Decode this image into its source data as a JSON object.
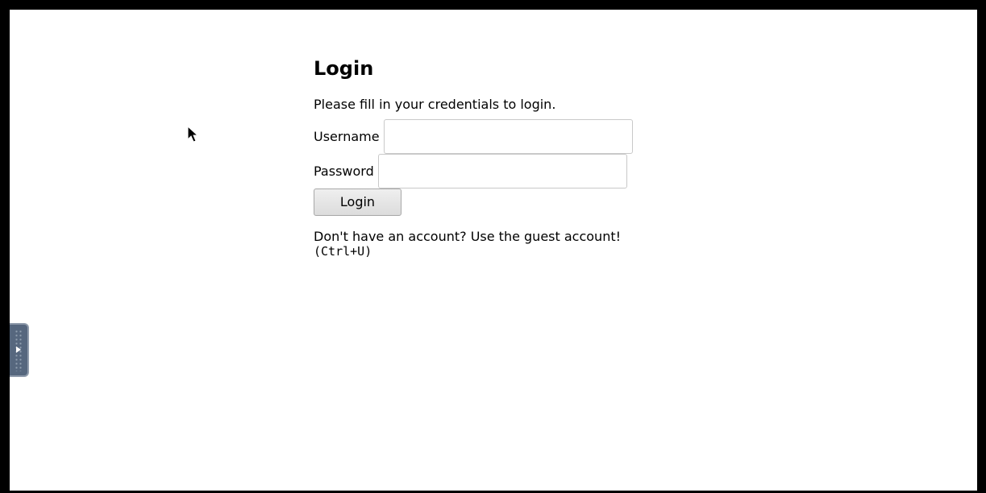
{
  "login": {
    "title": "Login",
    "intro": "Please fill in your credentials to login.",
    "username_label": "Username",
    "username_value": "",
    "password_label": "Password",
    "password_value": "",
    "submit_label": "Login",
    "guest_prompt": "Don't have an account? Use the guest account!",
    "guest_shortcut": "(Ctrl+U)"
  },
  "icons": {
    "cursor": "mouse-pointer-icon",
    "panel_toggle": "play-arrow-icon"
  },
  "colors": {
    "page_background": "#ffffff",
    "frame": "#000000",
    "handle_background": "#56677e"
  }
}
